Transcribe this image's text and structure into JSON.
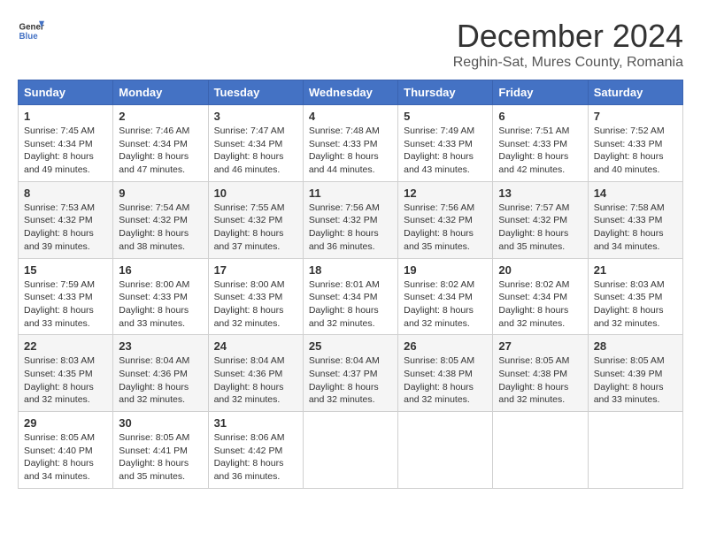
{
  "logo": {
    "general": "General",
    "blue": "Blue"
  },
  "title": "December 2024",
  "subtitle": "Reghin-Sat, Mures County, Romania",
  "days_header": [
    "Sunday",
    "Monday",
    "Tuesday",
    "Wednesday",
    "Thursday",
    "Friday",
    "Saturday"
  ],
  "weeks": [
    [
      {
        "day": "1",
        "sunrise": "7:45 AM",
        "sunset": "4:34 PM",
        "daylight": "8 hours and 49 minutes."
      },
      {
        "day": "2",
        "sunrise": "7:46 AM",
        "sunset": "4:34 PM",
        "daylight": "8 hours and 47 minutes."
      },
      {
        "day": "3",
        "sunrise": "7:47 AM",
        "sunset": "4:34 PM",
        "daylight": "8 hours and 46 minutes."
      },
      {
        "day": "4",
        "sunrise": "7:48 AM",
        "sunset": "4:33 PM",
        "daylight": "8 hours and 44 minutes."
      },
      {
        "day": "5",
        "sunrise": "7:49 AM",
        "sunset": "4:33 PM",
        "daylight": "8 hours and 43 minutes."
      },
      {
        "day": "6",
        "sunrise": "7:51 AM",
        "sunset": "4:33 PM",
        "daylight": "8 hours and 42 minutes."
      },
      {
        "day": "7",
        "sunrise": "7:52 AM",
        "sunset": "4:33 PM",
        "daylight": "8 hours and 40 minutes."
      }
    ],
    [
      {
        "day": "8",
        "sunrise": "7:53 AM",
        "sunset": "4:32 PM",
        "daylight": "8 hours and 39 minutes."
      },
      {
        "day": "9",
        "sunrise": "7:54 AM",
        "sunset": "4:32 PM",
        "daylight": "8 hours and 38 minutes."
      },
      {
        "day": "10",
        "sunrise": "7:55 AM",
        "sunset": "4:32 PM",
        "daylight": "8 hours and 37 minutes."
      },
      {
        "day": "11",
        "sunrise": "7:56 AM",
        "sunset": "4:32 PM",
        "daylight": "8 hours and 36 minutes."
      },
      {
        "day": "12",
        "sunrise": "7:56 AM",
        "sunset": "4:32 PM",
        "daylight": "8 hours and 35 minutes."
      },
      {
        "day": "13",
        "sunrise": "7:57 AM",
        "sunset": "4:32 PM",
        "daylight": "8 hours and 35 minutes."
      },
      {
        "day": "14",
        "sunrise": "7:58 AM",
        "sunset": "4:33 PM",
        "daylight": "8 hours and 34 minutes."
      }
    ],
    [
      {
        "day": "15",
        "sunrise": "7:59 AM",
        "sunset": "4:33 PM",
        "daylight": "8 hours and 33 minutes."
      },
      {
        "day": "16",
        "sunrise": "8:00 AM",
        "sunset": "4:33 PM",
        "daylight": "8 hours and 33 minutes."
      },
      {
        "day": "17",
        "sunrise": "8:00 AM",
        "sunset": "4:33 PM",
        "daylight": "8 hours and 32 minutes."
      },
      {
        "day": "18",
        "sunrise": "8:01 AM",
        "sunset": "4:34 PM",
        "daylight": "8 hours and 32 minutes."
      },
      {
        "day": "19",
        "sunrise": "8:02 AM",
        "sunset": "4:34 PM",
        "daylight": "8 hours and 32 minutes."
      },
      {
        "day": "20",
        "sunrise": "8:02 AM",
        "sunset": "4:34 PM",
        "daylight": "8 hours and 32 minutes."
      },
      {
        "day": "21",
        "sunrise": "8:03 AM",
        "sunset": "4:35 PM",
        "daylight": "8 hours and 32 minutes."
      }
    ],
    [
      {
        "day": "22",
        "sunrise": "8:03 AM",
        "sunset": "4:35 PM",
        "daylight": "8 hours and 32 minutes."
      },
      {
        "day": "23",
        "sunrise": "8:04 AM",
        "sunset": "4:36 PM",
        "daylight": "8 hours and 32 minutes."
      },
      {
        "day": "24",
        "sunrise": "8:04 AM",
        "sunset": "4:36 PM",
        "daylight": "8 hours and 32 minutes."
      },
      {
        "day": "25",
        "sunrise": "8:04 AM",
        "sunset": "4:37 PM",
        "daylight": "8 hours and 32 minutes."
      },
      {
        "day": "26",
        "sunrise": "8:05 AM",
        "sunset": "4:38 PM",
        "daylight": "8 hours and 32 minutes."
      },
      {
        "day": "27",
        "sunrise": "8:05 AM",
        "sunset": "4:38 PM",
        "daylight": "8 hours and 32 minutes."
      },
      {
        "day": "28",
        "sunrise": "8:05 AM",
        "sunset": "4:39 PM",
        "daylight": "8 hours and 33 minutes."
      }
    ],
    [
      {
        "day": "29",
        "sunrise": "8:05 AM",
        "sunset": "4:40 PM",
        "daylight": "8 hours and 34 minutes."
      },
      {
        "day": "30",
        "sunrise": "8:05 AM",
        "sunset": "4:41 PM",
        "daylight": "8 hours and 35 minutes."
      },
      {
        "day": "31",
        "sunrise": "8:06 AM",
        "sunset": "4:42 PM",
        "daylight": "8 hours and 36 minutes."
      },
      null,
      null,
      null,
      null
    ]
  ]
}
